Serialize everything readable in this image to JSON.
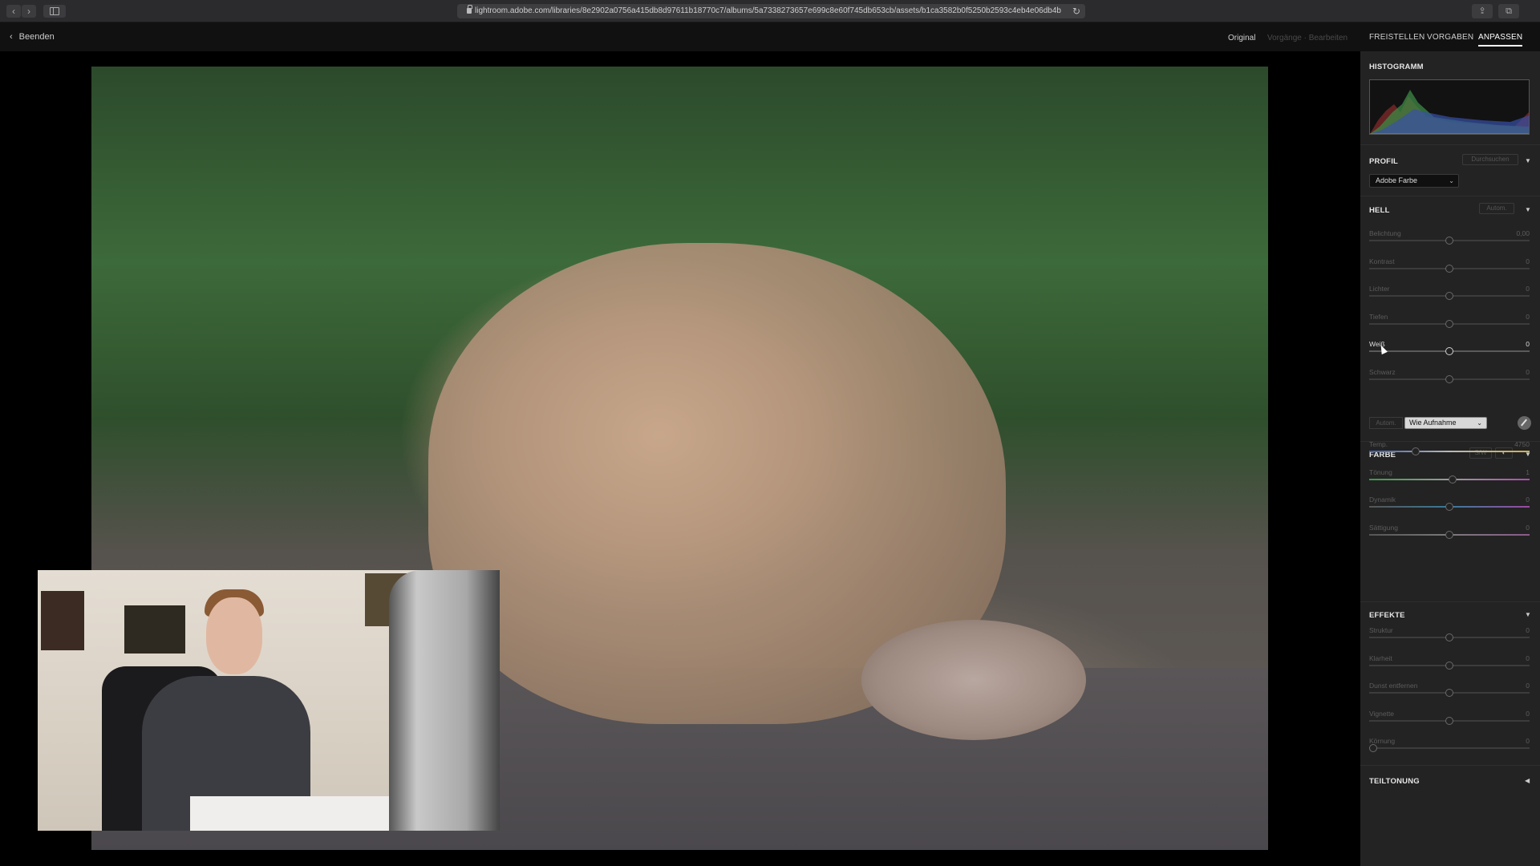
{
  "browser": {
    "url": "lightroom.adobe.com/libraries/8e2902a0756a415db8d97611b18770c7/albums/5a7338273657e699c8e60f745db653cb/assets/b1ca3582b0f5250b2593c4eb4e06db4b"
  },
  "appbar": {
    "back_label": "Beenden",
    "original_label": "Original",
    "disabled_label": "Vorgänge · Bearbeiten",
    "tabs": [
      "FREISTELLEN",
      "VORGABEN",
      "ANPASSEN"
    ],
    "active_tab": "ANPASSEN"
  },
  "panel": {
    "histogram_title": "HISTOGRAMM",
    "profile": {
      "title": "PROFIL",
      "browse_label": "Durchsuchen",
      "value": "Adobe Farbe"
    },
    "light": {
      "title": "HELL",
      "auto_label": "Autom.",
      "sliders": [
        {
          "label": "Belichtung",
          "value": "0,00",
          "pos": 0.5
        },
        {
          "label": "Kontrast",
          "value": "0",
          "pos": 0.5
        },
        {
          "label": "Lichter",
          "value": "0",
          "pos": 0.5
        },
        {
          "label": "Tiefen",
          "value": "0",
          "pos": 0.5
        },
        {
          "label": "Weiß",
          "value": "0",
          "pos": 0.5,
          "active": true
        },
        {
          "label": "Schwarz",
          "value": "0",
          "pos": 0.5
        }
      ]
    },
    "color": {
      "title": "FARBE",
      "bw_label": "S/W",
      "auto_label": "Autom.",
      "wb_value": "Wie Aufnahme",
      "sliders": [
        {
          "label": "Temp.",
          "value": "4750",
          "pos": 0.29,
          "gradient": "temp"
        },
        {
          "label": "Tönung",
          "value": "1",
          "pos": 0.52,
          "gradient": "tint"
        },
        {
          "label": "Dynamik",
          "value": "0",
          "pos": 0.5,
          "gradient": "vib"
        },
        {
          "label": "Sättigung",
          "value": "0",
          "pos": 0.5,
          "gradient": "sat"
        }
      ]
    },
    "effects": {
      "title": "EFFEKTE",
      "sliders": [
        {
          "label": "Struktur",
          "value": "0",
          "pos": 0.5
        },
        {
          "label": "Klarheit",
          "value": "0",
          "pos": 0.5
        },
        {
          "label": "Dunst entfernen",
          "value": "0",
          "pos": 0.5
        },
        {
          "label": "Vignette",
          "value": "0",
          "pos": 0.5
        },
        {
          "label": "Körnung",
          "value": "0",
          "pos": 0.0
        }
      ]
    },
    "split_toning": {
      "title": "TEILTONUNG"
    }
  }
}
